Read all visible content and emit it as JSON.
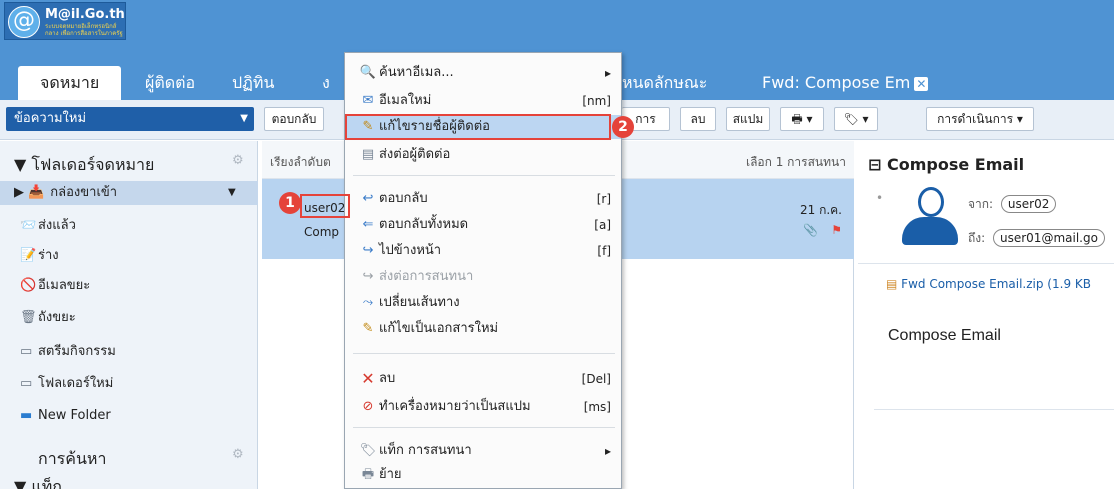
{
  "app": {
    "logo_text": "M@il.Go.th",
    "logo_sub": "ระบบจดหมายอิเล็กทรอนิกส์กลาง เพื่อการสื่อสารในภาครัฐ"
  },
  "tabs": [
    {
      "label": "จดหมาย",
      "active": true
    },
    {
      "label": "ผู้ติดต่อ"
    },
    {
      "label": "ปฏิทิน"
    },
    {
      "label": "ง"
    },
    {
      "label": "หนดลักษณะ"
    },
    {
      "label": "Fwd: Compose Em"
    }
  ],
  "toolbar": {
    "new_message": "ข้อความใหม่",
    "reply": "ตอบกลับ",
    "actions_partial": "การ",
    "delete": "ลบ",
    "spam": "สแปม",
    "more_actions": "การดำเนินการ"
  },
  "sidebar": {
    "folders_header": "โฟลเดอร์จดหมาย",
    "folders": [
      {
        "label": "กล่องขาเข้า",
        "icon": "inbox-icon"
      },
      {
        "label": "ส่งแล้ว",
        "icon": "sent-icon"
      },
      {
        "label": "ร่าง",
        "icon": "drafts-icon"
      },
      {
        "label": "อีเมลขยะ",
        "icon": "junk-icon"
      },
      {
        "label": "ถังขยะ",
        "icon": "trash-icon"
      },
      {
        "label": "สตรีมกิจกรรม",
        "icon": "folder-icon"
      },
      {
        "label": "โฟลเดอร์ใหม่",
        "icon": "folder-icon"
      },
      {
        "label": "New Folder",
        "icon": "folder-icon"
      }
    ],
    "search_header": "การค้นหา",
    "tags_header": "แท็ก"
  },
  "list": {
    "sort_label": "เรียงลำดับต",
    "selection": "เลือก 1 การสนทนา",
    "message": {
      "from": "user02",
      "subject": "Comp",
      "date": "21 ก.ค."
    }
  },
  "reading": {
    "title": "Compose Email",
    "from_label": "จาก:",
    "from": "user02",
    "to_label": "ถึง:",
    "to": "user01@mail.go",
    "attachment": "Fwd Compose Email.zip (1.9 KB",
    "body": "Compose Email"
  },
  "context_menu": {
    "items": [
      {
        "label": "ค้นหาอีเมล...",
        "icon": "search-icon",
        "submenu": true
      },
      {
        "label": "อีเมลใหม่",
        "icon": "new-email-icon",
        "shortcut": "[nm]"
      },
      {
        "label": "แก้ไขรายชื่อผู้ติดต่อ",
        "icon": "pencil-icon",
        "highlighted": true
      },
      {
        "label": "ส่งต่อผู้ติดต่อ",
        "icon": "contact-card-icon"
      },
      {
        "label": "ตอบกลับ",
        "icon": "reply-icon",
        "shortcut": "[r]"
      },
      {
        "label": "ตอบกลับทั้งหมด",
        "icon": "reply-all-icon",
        "shortcut": "[a]"
      },
      {
        "label": "ไปข้างหน้า",
        "icon": "forward-icon",
        "shortcut": "[f]"
      },
      {
        "label": "ส่งต่อการสนทนา",
        "icon": "forward-conversation-icon",
        "disabled": true
      },
      {
        "label": "เปลี่ยนเส้นทาง",
        "icon": "redirect-icon"
      },
      {
        "label": "แก้ไขเป็นเอกสารใหม่",
        "icon": "pencil-icon"
      },
      {
        "label": "ลบ",
        "icon": "delete-icon",
        "shortcut": "[Del]"
      },
      {
        "label": "ทำเครื่องหมายว่าเป็นสแปม",
        "icon": "spam-icon",
        "shortcut": "[ms]"
      },
      {
        "label": "แท็ก การสนทนา",
        "icon": "tag-icon",
        "submenu": true
      },
      {
        "label": "ย้าย",
        "icon": "move-icon"
      }
    ]
  },
  "callouts": [
    "1",
    "2"
  ],
  "colors": {
    "header_blue": "#4f93d3",
    "menu_highlight": "#bcd6f2",
    "callout_red": "#e5433a",
    "selected_row": "#b7d3f0"
  }
}
